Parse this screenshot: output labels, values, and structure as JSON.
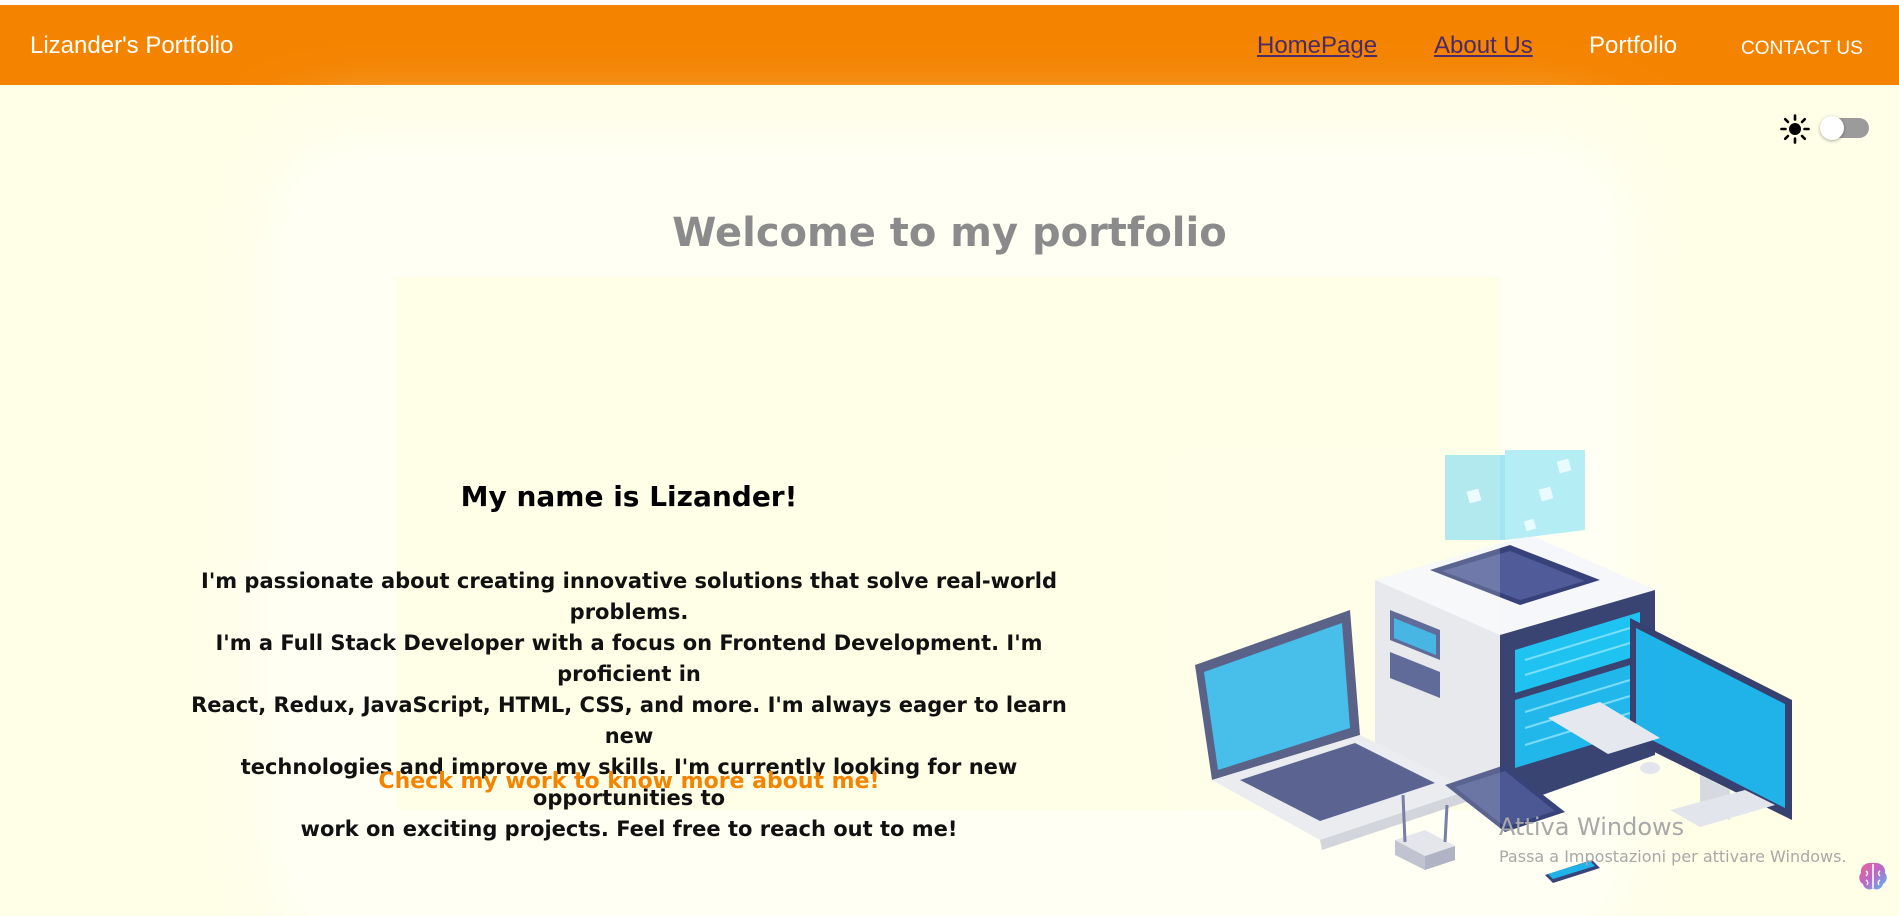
{
  "navbar": {
    "brand": "Lizander's Portfolio",
    "links": [
      {
        "label": "HomePage"
      },
      {
        "label": "About Us"
      },
      {
        "label": "Portfolio"
      }
    ],
    "contact": "CONTACT US",
    "bg_color": "#f48400"
  },
  "theme": {
    "sun_icon": "sun-icon",
    "toggle_state": "off"
  },
  "hero": {
    "welcome": "Welcome to my portfolio",
    "name_heading": "My name is Lizander!",
    "bio_lines": [
      "I'm passionate about creating innovative solutions that solve real-world problems.",
      "I'm a Full Stack Developer with a focus on Frontend Development. I'm proficient in",
      "React, Redux, JavaScript, HTML, CSS, and more. I'm always eager to learn new",
      "technologies and improve my skills. I'm currently looking for new opportunities to",
      "work on exciting projects. Feel free to reach out to me!"
    ],
    "cta": "Check my work to know more about me!",
    "accent_color": "#f48400",
    "illustration": "isometric-devices-illustration"
  },
  "watermark": {
    "title": "Attiva Windows",
    "subtitle": "Passa a Impostazioni per attivare Windows."
  },
  "taskbar_icon": "brain-icon"
}
